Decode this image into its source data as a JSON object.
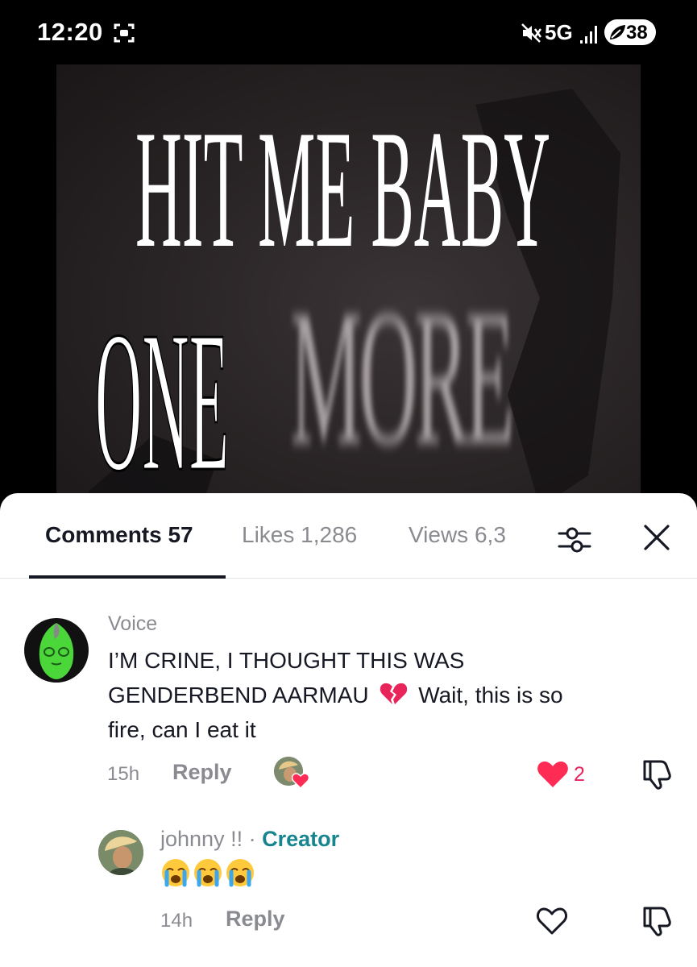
{
  "status_bar": {
    "time": "12:20",
    "network": "5G",
    "battery_level": "38",
    "icons": [
      "screen-record-icon",
      "mute-icon",
      "signal-icon",
      "battery-leaf-icon"
    ]
  },
  "video": {
    "title_line1": "HIT ME BABY",
    "title_line2": "ONE",
    "title_blurred": "MORE"
  },
  "tabs": {
    "comments": "Comments 57",
    "likes": "Likes 1,286",
    "views": "Views 6,3"
  },
  "comments": [
    {
      "username": "Voice",
      "text_line1": "I’M CRINE, I THOUGHT THIS WAS",
      "text_line2_a": "GENDERBEND AARMAU",
      "text_line2_b": "Wait, this is so",
      "text_line3": "fire, can I eat it",
      "time": "15h",
      "reply_label": "Reply",
      "like_count": "2",
      "liked": true
    },
    {
      "username": "johnny !!",
      "separator": " · ",
      "badge": "Creator",
      "text": "😭😭😭",
      "time": "14h",
      "reply_label": "Reply",
      "liked": false
    }
  ],
  "colors": {
    "accent_like": "#fe2c55",
    "creator_badge": "#16858f",
    "muted_text": "#8a8b91",
    "primary_text": "#161823"
  }
}
